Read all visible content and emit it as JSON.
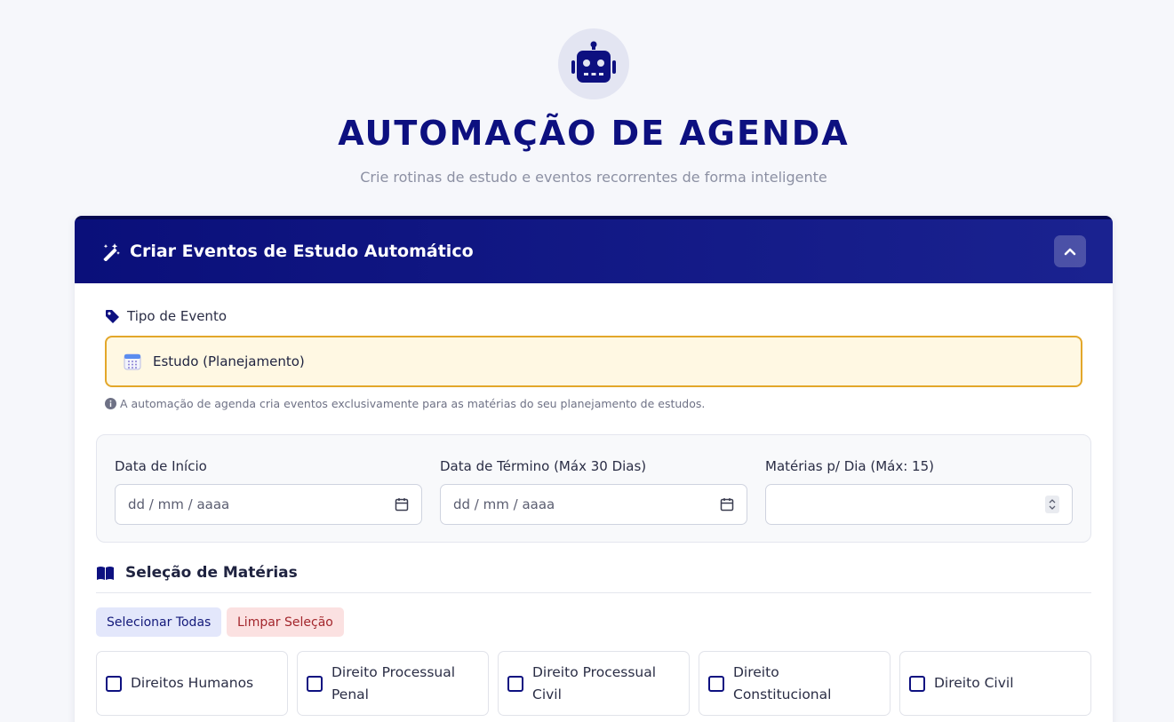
{
  "header": {
    "title": "AUTOMAÇÃO DE AGENDA",
    "subtitle": "Crie rotinas de estudo e eventos recorrentes de forma inteligente"
  },
  "card": {
    "title": "Criar Eventos de Estudo Automático"
  },
  "event_type": {
    "label": "Tipo de Evento",
    "selected": "Estudo (Planejamento)",
    "note": "A automação de agenda cria eventos exclusivamente para as matérias do seu planejamento de estudos."
  },
  "dates": {
    "start_label": "Data de Início",
    "start_placeholder": "dd / mm / aaaa",
    "end_label": "Data de Término (Máx 30 Dias)",
    "end_placeholder": "dd / mm / aaaa",
    "per_day_label": "Matérias p/ Dia (Máx: 15)",
    "per_day_value": ""
  },
  "subjects": {
    "title": "Seleção de Matérias",
    "select_all_label": "Selecionar Todas",
    "clear_label": "Limpar Seleção",
    "items": [
      {
        "label": "Direitos Humanos",
        "checked": false
      },
      {
        "label": "Direito Processual Penal",
        "checked": false
      },
      {
        "label": "Direito Processual Civil",
        "checked": false
      },
      {
        "label": "Direito Constitucional",
        "checked": false
      },
      {
        "label": "Direito Civil",
        "checked": false
      }
    ]
  },
  "colors": {
    "primary": "#0d1080",
    "header_bg": "#0a0f7a",
    "event_box_bg": "#fff8e3",
    "event_box_border": "#e3a72a",
    "select_all_bg": "#e3e7fb",
    "clear_bg": "#fbe1e1"
  },
  "icons": {
    "hero": "robot-icon",
    "card_header": "magic-wand-icon",
    "collapse": "chevron-up-icon",
    "event_label": "tag-icon",
    "event_option": "calendar-emoji-icon",
    "note": "info-circle-icon",
    "date_picker": "calendar-icon",
    "section": "book-open-icon"
  }
}
